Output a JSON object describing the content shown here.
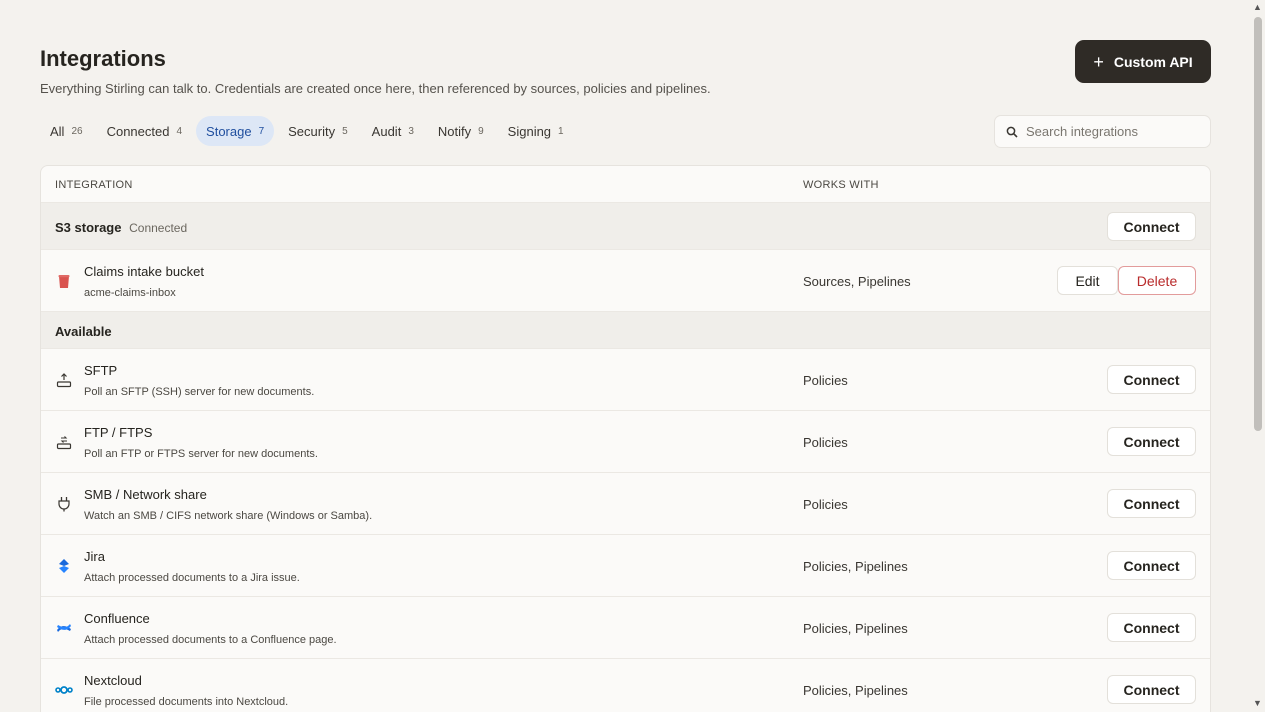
{
  "header": {
    "title": "Integrations",
    "subtitle": "Everything Stirling can talk to. Credentials are created once here, then referenced by sources, policies and pipelines.",
    "custom_api_label": "Custom API",
    "custom_api_icon": "plus-icon"
  },
  "filters": {
    "tabs": [
      {
        "label": "All",
        "count": "26",
        "active": false
      },
      {
        "label": "Connected",
        "count": "4",
        "active": false
      },
      {
        "label": "Storage",
        "count": "7",
        "active": true
      },
      {
        "label": "Security",
        "count": "5",
        "active": false
      },
      {
        "label": "Audit",
        "count": "3",
        "active": false
      },
      {
        "label": "Notify",
        "count": "9",
        "active": false
      },
      {
        "label": "Signing",
        "count": "1",
        "active": false
      }
    ],
    "search_placeholder": "Search integrations",
    "search_icon": "search-icon"
  },
  "table": {
    "col_integration": "INTEGRATION",
    "col_works_with": "WORKS WITH",
    "s3_group": {
      "title": "S3 storage",
      "status": "Connected",
      "connect_label": "Connect"
    },
    "connected_item": {
      "name": "Claims intake bucket",
      "desc": "acme-claims-inbox",
      "works": "Sources, Pipelines",
      "edit_label": "Edit",
      "delete_label": "Delete",
      "icon": "bucket-icon",
      "icon_color": "#d9534f"
    },
    "available_title": "Available",
    "available": [
      {
        "name": "SFTP",
        "desc": "Poll an SFTP (SSH) server for new documents.",
        "works": "Policies",
        "connect": "Connect",
        "icon": "upload-server-icon"
      },
      {
        "name": "FTP / FTPS",
        "desc": "Poll an FTP or FTPS server for new documents.",
        "works": "Policies",
        "connect": "Connect",
        "icon": "transfer-server-icon"
      },
      {
        "name": "SMB / Network share",
        "desc": "Watch an SMB / CIFS network share (Windows or Samba).",
        "works": "Policies",
        "connect": "Connect",
        "icon": "plug-icon"
      },
      {
        "name": "Jira",
        "desc": "Attach processed documents to a Jira issue.",
        "works": "Policies, Pipelines",
        "connect": "Connect",
        "icon": "jira-icon"
      },
      {
        "name": "Confluence",
        "desc": "Attach processed documents to a Confluence page.",
        "works": "Policies, Pipelines",
        "connect": "Connect",
        "icon": "confluence-icon"
      },
      {
        "name": "Nextcloud",
        "desc": "File processed documents into Nextcloud.",
        "works": "Policies, Pipelines",
        "connect": "Connect",
        "icon": "nextcloud-icon"
      }
    ]
  }
}
